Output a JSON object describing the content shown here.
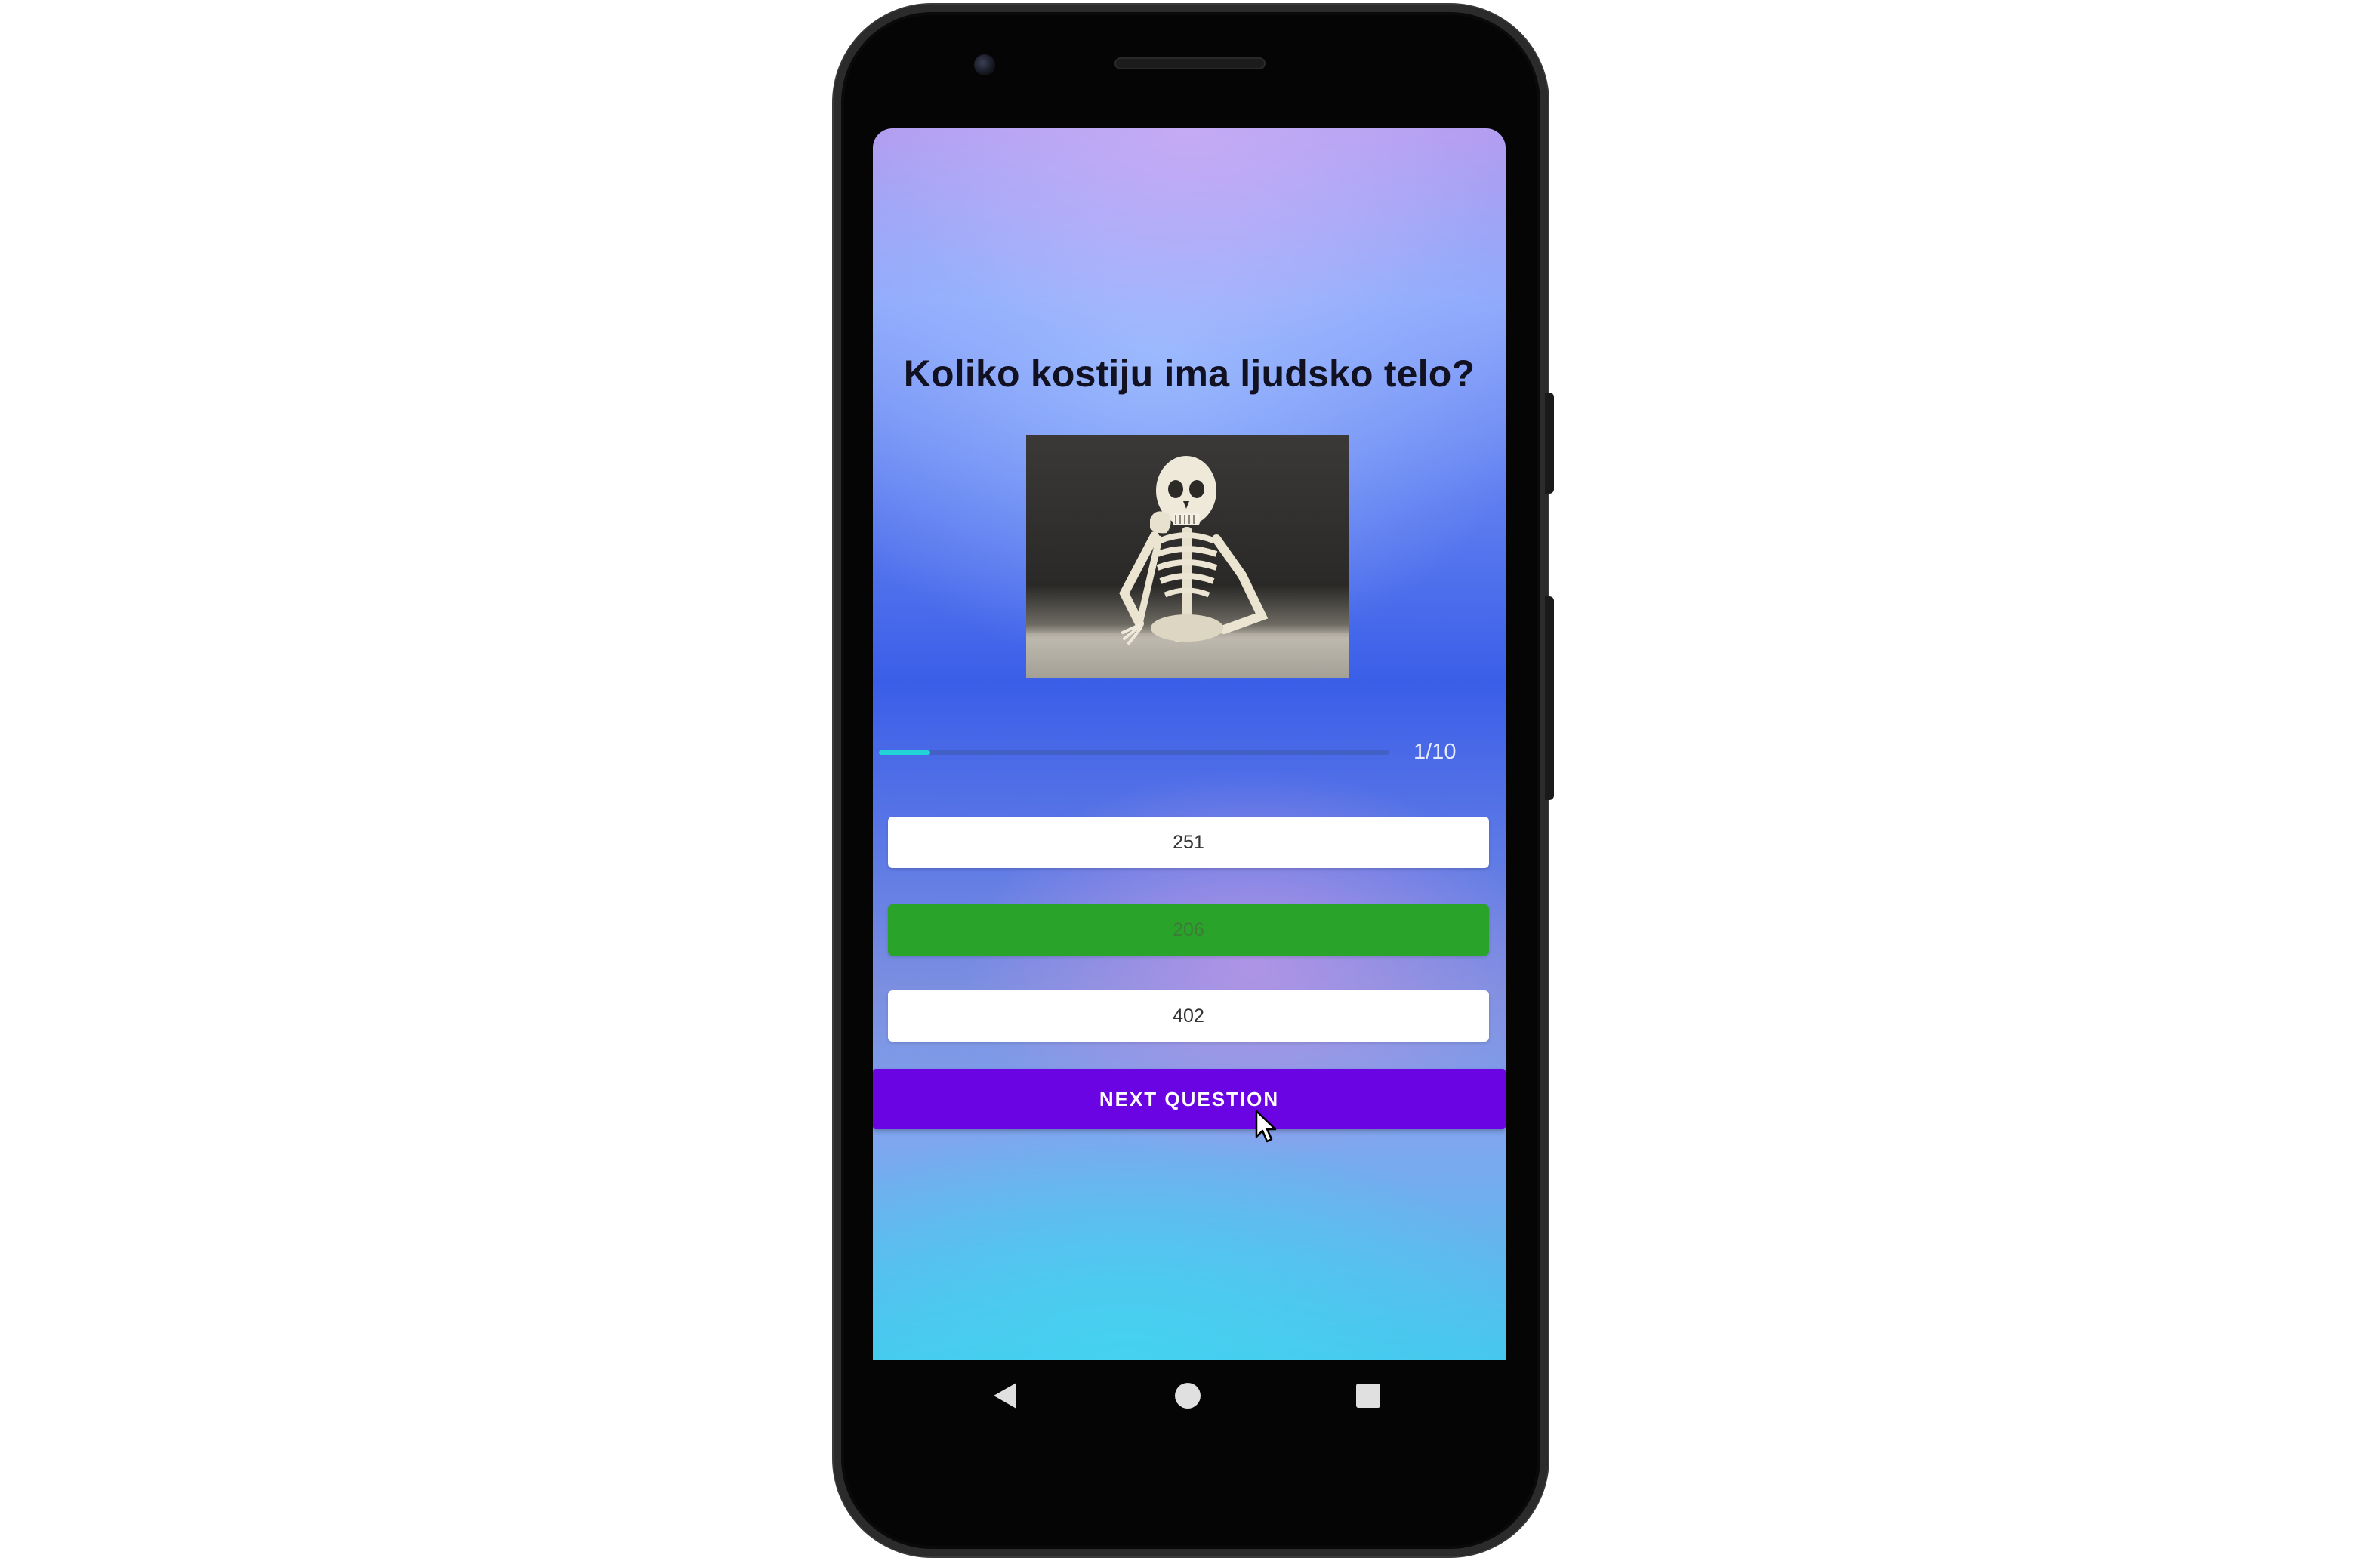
{
  "quiz": {
    "question": "Koliko kostiju ima ljudsko telo?",
    "image_alt": "skeleton resting chin on hand",
    "progress": {
      "label": "1/10",
      "current": 1,
      "total": 10,
      "fraction": 0.1
    },
    "answers": [
      {
        "label": "251",
        "state": "default"
      },
      {
        "label": "206",
        "state": "correct"
      },
      {
        "label": "402",
        "state": "default"
      }
    ],
    "next_button_label": "NEXT QUESTION"
  },
  "colors": {
    "next_button": "#6a04e2",
    "correct_answer": "#2aa32a",
    "progress_fill": "#22d3d8",
    "answer_default": "#ffffff"
  },
  "navbar": {
    "back_icon": "triangle-back-icon",
    "home_icon": "circle-home-icon",
    "recents_icon": "square-recents-icon"
  }
}
